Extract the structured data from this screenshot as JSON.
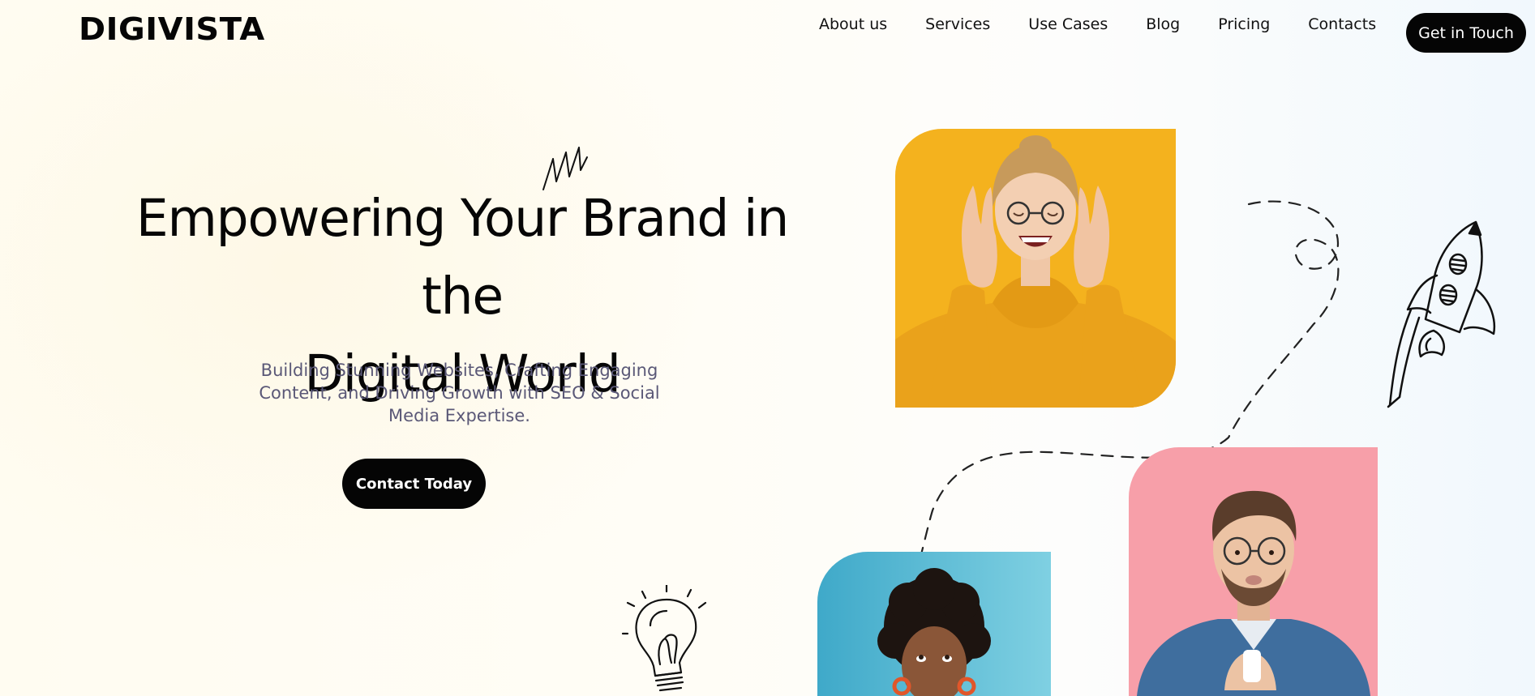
{
  "header": {
    "logo": "DIGIVISTA",
    "nav": [
      {
        "label": "About us"
      },
      {
        "label": "Services"
      },
      {
        "label": "Use Cases"
      },
      {
        "label": "Blog"
      },
      {
        "label": "Pricing"
      },
      {
        "label": "Contacts"
      }
    ],
    "cta_label": "Get in Touch"
  },
  "hero": {
    "title_line1": "Empowering Your Brand in the",
    "title_line2": "Digital World",
    "subtitle": "Building Stunning Websites, Crafting Engaging Content, and Driving Growth with SEO & Social Media Expertise.",
    "cta_label": "Contact Today"
  },
  "photos": [
    {
      "name": "excited-woman-photo",
      "background": "#f4b21e"
    },
    {
      "name": "thinking-man-photo",
      "background": "#f79fa9"
    },
    {
      "name": "curly-hair-woman-photo",
      "background": "#5bbcd8"
    }
  ],
  "colors": {
    "button_bg": "#050505",
    "button_text": "#ffffff",
    "subtitle_text": "#5a5877"
  },
  "icons": [
    "scribble-icon",
    "rocket-icon",
    "lightbulb-icon",
    "dashed-path-decoration"
  ]
}
